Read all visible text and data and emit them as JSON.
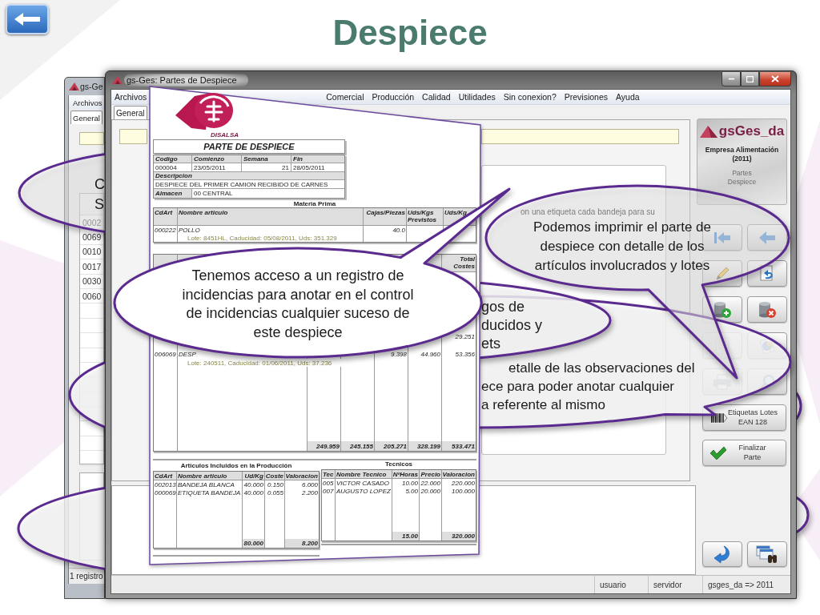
{
  "slide_title": "Despiece",
  "back_window": {
    "title": "gs-Ge",
    "menu": [
      "Archivos"
    ],
    "tabs": [
      {
        "label": "General",
        "selected": true
      }
    ],
    "rows": [
      "0002",
      "0069",
      "0010",
      "0017",
      "0030",
      "0060"
    ],
    "status": "1 registro"
  },
  "main_window": {
    "title": "gs-Ges: Partes de Despiece",
    "menu_left": [
      "Archivos"
    ],
    "menu_right": [
      "Comercial",
      "Producción",
      "Calidad",
      "Utilidades",
      "Sin conexion?",
      "Previsiones",
      "Ayuda"
    ],
    "tabs": [
      {
        "label": "General",
        "selected": true
      }
    ],
    "notes_fragment": "on una etiqueta cada bandeja para su",
    "brand": {
      "name": "gsGes_da",
      "company": "Empresa Alimentación\n(2011)",
      "module": "Partes\nDespiece"
    },
    "action_buttons": [
      {
        "label": "Etiquetas Lotes\nEAN 128"
      },
      {
        "label": "Finalizar\nParte"
      }
    ],
    "status_bar": [
      "usuario",
      "servidor",
      "gsges_da => 2011"
    ]
  },
  "document": {
    "company": "DISALSA",
    "title": "PARTE DE DESPIECE",
    "info_headers": [
      "Codigo",
      "Comienzo",
      "Semana",
      "Fin"
    ],
    "info_values": [
      "000004",
      "23/05/2011",
      "21",
      "28/05/2011"
    ],
    "description_label": "Descripcion",
    "description": "DESPIECE DEL PRIMER CAMION RECIBIDO DE CARNES",
    "warehouse_label": "Almacen",
    "warehouse": "00 CENTRAL",
    "raw_material": {
      "title": "Materia Prima",
      "columns": [
        "CdArt",
        "Nombre articulo",
        "Cajas/Piezas",
        "Uds/Kgs\nPrevistos",
        "Uds/Kg"
      ],
      "rows": [
        {
          "cells": [
            "000222",
            "POLLO",
            "40.0"
          ],
          "lot": "Lote: 8451HL, Caducidad: 05/08/2011, Uds: 351.329"
        }
      ]
    },
    "products": {
      "header": {
        "column_7": "Total\nCostes"
      },
      "rows": [
        {
          "column_7": "29.251"
        },
        {
          "column_1": "006069",
          "column_2": "DESP",
          "column_5": "9.398",
          "column_6": "44.960",
          "column_7": "53.356",
          "lot": "Lote: 240511, Caducidad: 01/06/2011, Uds: 37.236"
        }
      ],
      "totals": {
        "column_3": "249.959",
        "column_4": "245.155",
        "column_5": "205.271",
        "column_6": "328.199",
        "column_7": "533.471"
      }
    },
    "materials": {
      "title": "Articulos Incluidos en la Producción",
      "columns": [
        "CdArt",
        "Nombre articulo",
        "Ud/Kg",
        "Coste",
        "Valoracion"
      ],
      "rows": [
        [
          "002013",
          "BANDEJA BLANCA",
          "40.000",
          "0.150",
          "6.000"
        ],
        [
          "000069",
          "ETIQUETA BANDEJA",
          "40.000",
          "0.055",
          "2.200"
        ]
      ],
      "totals": {
        "column_3": "80.000",
        "column_5": "8.200"
      }
    },
    "technicians": {
      "title": "Tecnicos",
      "columns": [
        "Tec",
        "Nombre Tecnico",
        "NºHoras",
        "Precio",
        "Valoracion"
      ],
      "rows": [
        [
          "005",
          "VICTOR CASADO",
          "10.00",
          "22.000",
          "220.000"
        ],
        [
          "007",
          "AUGUSTO LOPEZ",
          "5.00",
          "20.000",
          "100.000"
        ]
      ],
      "totals": {
        "column_3": "15.00",
        "column_5": "320.000"
      }
    }
  },
  "callouts": [
    {
      "text": "C\nS"
    },
    {
      "text": "Podemos imprimir el parte de\ndespiece con detalle de los\nartículos involucrados y lotes"
    },
    {
      "text": "Tenemos acceso a un registro de\nincidencias para anotar en el control\nde incidencias cualquier suceso de\neste despiece"
    },
    {
      "text": "gos de\nducidos y\nets"
    },
    {
      "text": "etalle de las observaciones del\nece para poder anotar cualquier\na referente al mismo"
    }
  ]
}
